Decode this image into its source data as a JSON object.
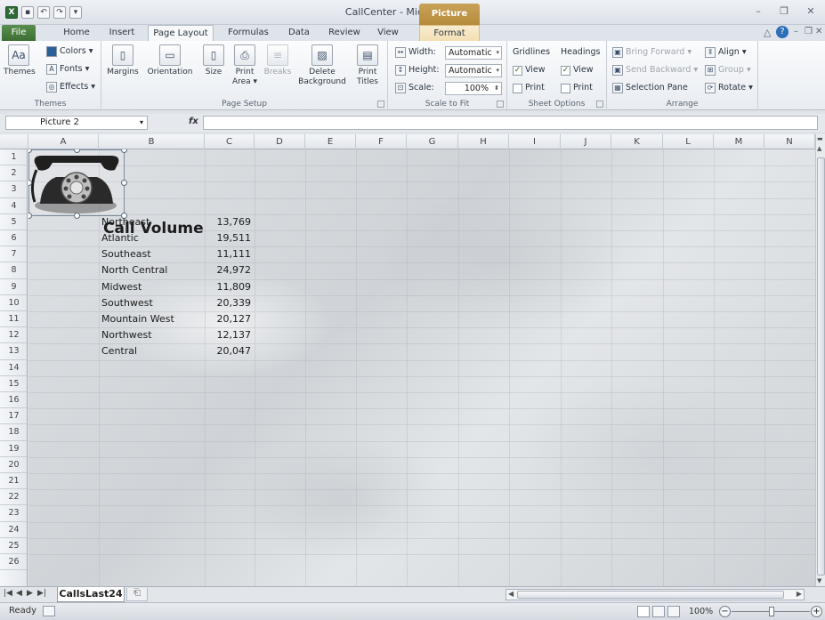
{
  "window": {
    "title": "CallCenter - Microsoft Excel",
    "context_tab": "Picture Tools"
  },
  "ribbon_tabs": [
    "File",
    "Home",
    "Insert",
    "Page Layout",
    "Formulas",
    "Data",
    "Review",
    "View",
    "Format"
  ],
  "active_tab": "Page Layout",
  "ribbon": {
    "themes": {
      "label": "Themes",
      "btn": "Themes",
      "colors": "Colors",
      "fonts": "Fonts",
      "effects": "Effects"
    },
    "page_setup": {
      "label": "Page Setup",
      "margins": "Margins",
      "orientation": "Orientation",
      "size": "Size",
      "print_area_1": "Print",
      "print_area_2": "Area",
      "breaks": "Breaks",
      "delete_bg_1": "Delete",
      "delete_bg_2": "Background",
      "print_titles_1": "Print",
      "print_titles_2": "Titles"
    },
    "scale_to_fit": {
      "label": "Scale to Fit",
      "width_label": "Width:",
      "width_value": "Automatic",
      "height_label": "Height:",
      "height_value": "Automatic",
      "scale_label": "Scale:",
      "scale_value": "100%"
    },
    "sheet_options": {
      "label": "Sheet Options",
      "gridlines": "Gridlines",
      "headings": "Headings",
      "view": "View",
      "print": "Print"
    },
    "arrange": {
      "label": "Arrange",
      "bring_forward": "Bring Forward",
      "send_backward": "Send Backward",
      "selection_pane": "Selection Pane",
      "align": "Align",
      "group": "Group",
      "rotate": "Rotate"
    }
  },
  "formula_bar": {
    "name_box": "Picture 2",
    "fx": "fx",
    "value": ""
  },
  "columns": [
    "A",
    "B",
    "C",
    "D",
    "E",
    "F",
    "G",
    "H",
    "I",
    "J",
    "K",
    "L",
    "M",
    "N"
  ],
  "rows": [
    "1",
    "2",
    "3",
    "4",
    "5",
    "6",
    "7",
    "8",
    "9",
    "10",
    "11",
    "12",
    "13",
    "14",
    "15",
    "16",
    "17",
    "18",
    "19",
    "20",
    "21",
    "22",
    "23",
    "24",
    "25",
    "26"
  ],
  "sheet": {
    "title": "Call Volume",
    "data": [
      {
        "region": "Northeast",
        "calls": "13,769"
      },
      {
        "region": "Atlantic",
        "calls": "19,511"
      },
      {
        "region": "Southeast",
        "calls": "11,111"
      },
      {
        "region": "North Central",
        "calls": "24,972"
      },
      {
        "region": "Midwest",
        "calls": "11,809"
      },
      {
        "region": "Southwest",
        "calls": "20,339"
      },
      {
        "region": "Mountain West",
        "calls": "20,127"
      },
      {
        "region": "Northwest",
        "calls": "12,137"
      },
      {
        "region": "Central",
        "calls": "20,047"
      }
    ]
  },
  "sheet_tabs": [
    "CallsLast24"
  ],
  "status": {
    "ready": "Ready",
    "zoom": "100%"
  }
}
